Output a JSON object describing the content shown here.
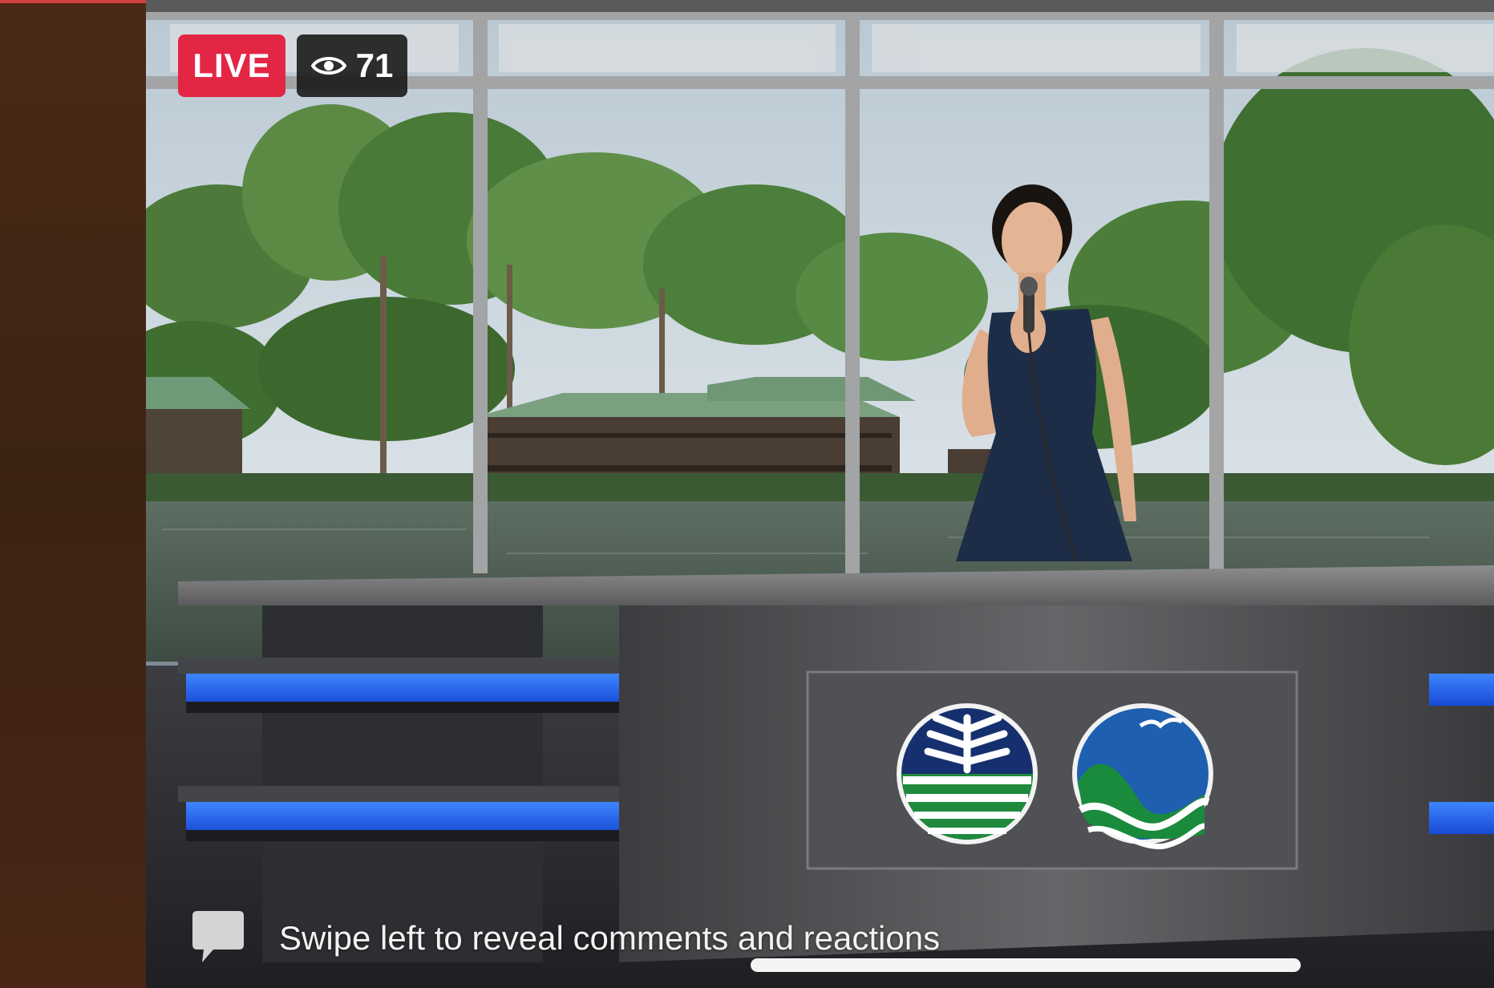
{
  "stream": {
    "live_label": "LIVE",
    "viewer_count": "71",
    "hint_text": "Swipe left to reveal comments and reactions"
  },
  "icons": {
    "viewers": "eye-icon",
    "comments": "speech-bubble-icon",
    "emblem_left": "denr-emblem-icon",
    "emblem_right": "bay-emblem-icon"
  },
  "colors": {
    "live_red": "#e42645",
    "badge_dark": "#141414",
    "side_panel": "#3b2314",
    "desk_blue": "#1e63ff"
  }
}
